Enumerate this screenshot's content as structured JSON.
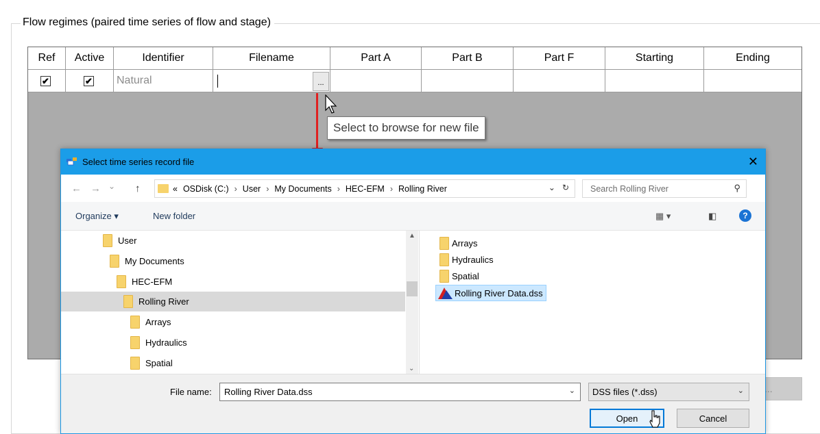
{
  "group": {
    "title": "Flow regimes (paired time series of flow and stage)"
  },
  "grid": {
    "headers": [
      "Ref",
      "Active",
      "Identifier",
      "Filename",
      "Part A",
      "Part B",
      "Part F",
      "Starting",
      "Ending"
    ],
    "row": {
      "ref_checked": "✔",
      "active_checked": "✔",
      "identifier": "Natural",
      "filename": "",
      "browse_label": "..."
    }
  },
  "tooltip": {
    "text": "Select to browse for new file"
  },
  "behind_button": {
    "label": "..."
  },
  "dialog": {
    "title": "Select time series record file",
    "close_label": "✕",
    "nav": {
      "back": "←",
      "forward": "→",
      "recent": "⌄",
      "up": "↑"
    },
    "address": {
      "overflow": "«",
      "segments": [
        "OSDisk (C:)",
        "User",
        "My Documents",
        "HEC-EFM",
        "Rolling River"
      ],
      "separator": "›",
      "dropdown": "⌄",
      "refresh": "↻"
    },
    "search": {
      "placeholder": "Search Rolling River",
      "icon": "⚲"
    },
    "toolbar": {
      "organize": "Organize ▾",
      "new_folder": "New folder",
      "view": "▦ ▾",
      "pane": "◧",
      "help": "?"
    },
    "tree": [
      {
        "label": "User"
      },
      {
        "label": "My Documents"
      },
      {
        "label": "HEC-EFM"
      },
      {
        "label": "Rolling River"
      },
      {
        "label": "Arrays"
      },
      {
        "label": "Hydraulics"
      },
      {
        "label": "Spatial"
      }
    ],
    "scroll": {
      "up": "▲",
      "down": "⌄"
    },
    "files": [
      {
        "label": "Arrays"
      },
      {
        "label": "Hydraulics"
      },
      {
        "label": "Spatial"
      },
      {
        "label": "Rolling River Data.dss"
      }
    ],
    "bottom": {
      "file_name_label": "File name:",
      "file_name_value": "Rolling River Data.dss",
      "file_type": "DSS files (*.dss)",
      "dropdown": "⌄",
      "open": "Open",
      "cancel": "Cancel"
    }
  },
  "colors": {
    "accent": "#1b9de8",
    "arrow": "#e02020",
    "folder": "#f7d36c",
    "grid_bg": "#ababab"
  }
}
